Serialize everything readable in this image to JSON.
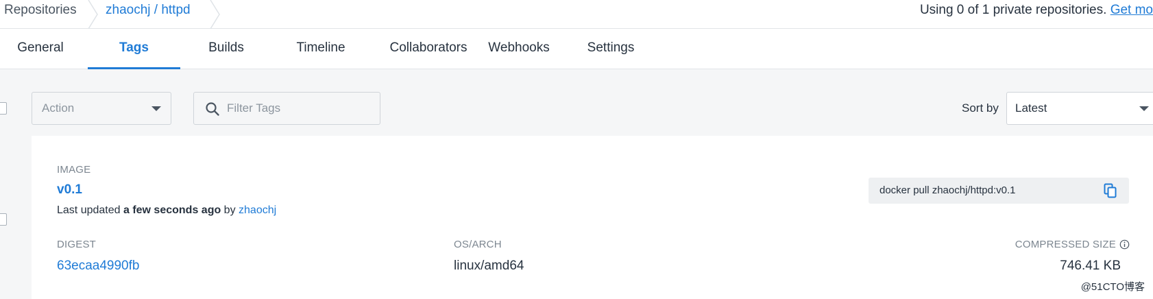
{
  "breadcrumb": {
    "root": "Repositories",
    "repo": "zhaochj / httpd"
  },
  "usage": {
    "text": "Using 0 of 1 private repositories. ",
    "link": "Get mo"
  },
  "tabs": [
    {
      "label": "General"
    },
    {
      "label": "Tags",
      "active": true
    },
    {
      "label": "Builds"
    },
    {
      "label": "Timeline"
    },
    {
      "label": "Collaborators"
    },
    {
      "label": "Webhooks"
    },
    {
      "label": "Settings"
    }
  ],
  "toolbar": {
    "action_placeholder": "Action",
    "filter_placeholder": "Filter Tags",
    "sort_label": "Sort by",
    "sort_value": "Latest"
  },
  "tag": {
    "image_heading": "IMAGE",
    "name": "v0.1",
    "updated_prefix": "Last updated ",
    "updated_when": "a few seconds ago",
    "updated_by_prefix": " by ",
    "updated_by": "zhaochj",
    "pull_command": "docker pull zhaochj/httpd:v0.1",
    "digest_heading": "DIGEST",
    "digest": "63ecaa4990fb",
    "os_heading": "OS/ARCH",
    "os_arch": "linux/amd64",
    "size_heading": "COMPRESSED SIZE",
    "size": "746.41 KB"
  },
  "watermark": "@51CTO博客",
  "icons": {
    "filter": "search-icon",
    "copy": "copy-icon",
    "info": "info-icon",
    "dropdown": "caret-down-icon"
  },
  "colors": {
    "accent": "#1f7bd6",
    "text": "#27323f",
    "muted": "#7c8690",
    "background": "#f5f6f7"
  }
}
